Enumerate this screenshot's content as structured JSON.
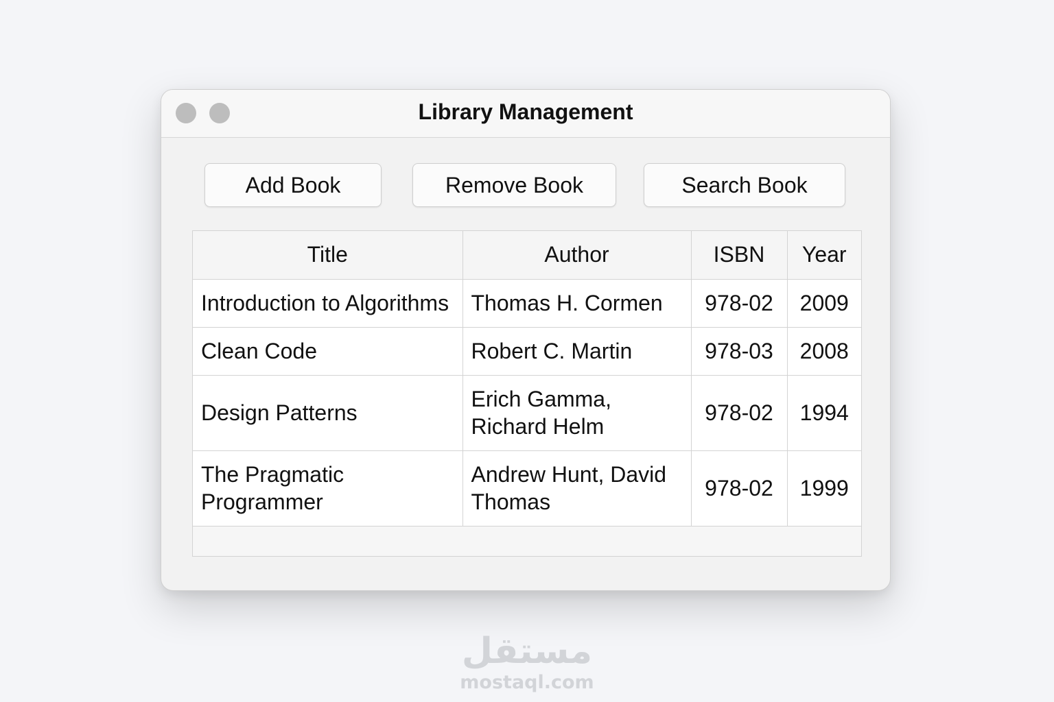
{
  "window": {
    "title": "Library Management"
  },
  "toolbar": {
    "add_label": "Add Book",
    "remove_label": "Remove Book",
    "search_label": "Search Book"
  },
  "table": {
    "columns": [
      "Title",
      "Author",
      "ISBN",
      "Year"
    ],
    "rows": [
      {
        "title": "Introduction to Algorithms",
        "author": "Thomas H. Cormen",
        "isbn": "978-02",
        "year": "2009"
      },
      {
        "title": "Clean Code",
        "author": "Robert C. Martin",
        "isbn": "978-03",
        "year": "2008"
      },
      {
        "title": "Design Patterns",
        "author": "Erich Gamma, Richard Helm",
        "isbn": "978-02",
        "year": "1994"
      },
      {
        "title": "The Pragmatic Programmer",
        "author": "Andrew Hunt, David Thomas",
        "isbn": "978-02",
        "year": "1999"
      }
    ]
  },
  "watermark": {
    "arabic": "مستقل",
    "domain": "mostaql.com"
  },
  "colors": {
    "background": "#f4f5f8",
    "window": "#f2f2f2",
    "traffic_light": "#bdbdbd",
    "border": "#d3d3d3"
  }
}
